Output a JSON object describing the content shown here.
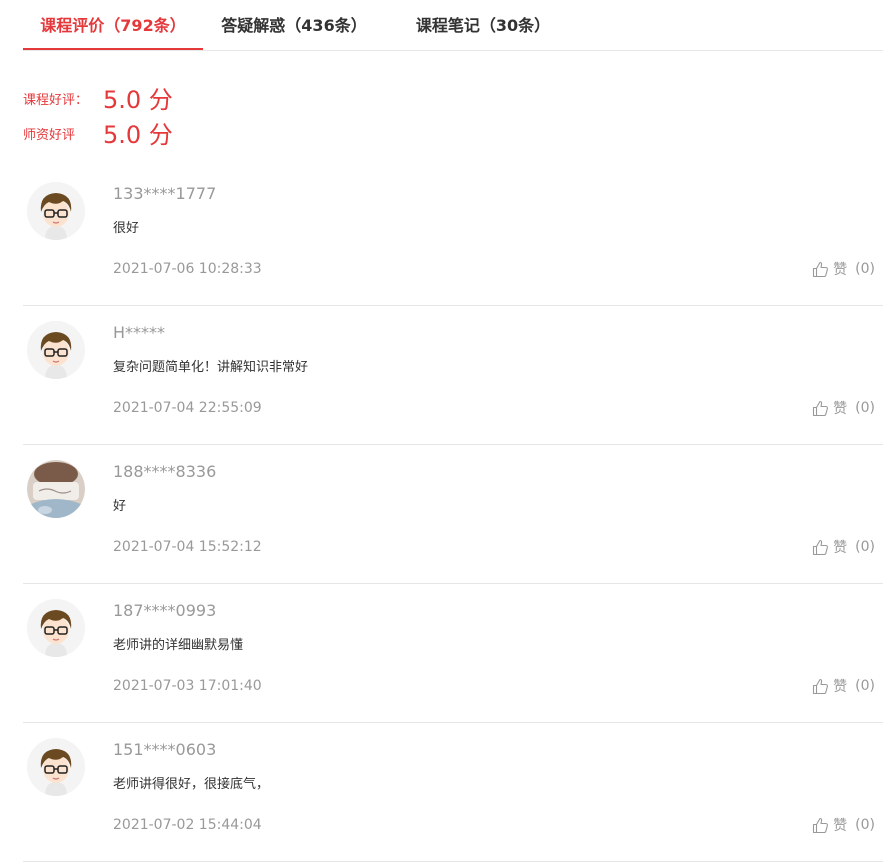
{
  "tabs": [
    {
      "label": "课程评价（792条）",
      "active": true
    },
    {
      "label": "答疑解惑（436条）",
      "active": false
    },
    {
      "label": "课程笔记（30条）",
      "active": false
    }
  ],
  "ratings": [
    {
      "label": "课程好评：",
      "value": "5.0 分"
    },
    {
      "label": "师资好评",
      "value": "5.0 分"
    }
  ],
  "comments": [
    {
      "user": "133****1777",
      "text": "很好",
      "time": "2021-07-06 10:28:33",
      "like_label": "赞",
      "like_count": "(0)",
      "avatar": "cartoon-boy-avatar"
    },
    {
      "user": "H*****",
      "text": "复杂问题简单化！讲解知识非常好",
      "time": "2021-07-04 22:55:09",
      "like_label": "赞",
      "like_count": "(0)",
      "avatar": "cartoon-boy-avatar"
    },
    {
      "user": "188****8336",
      "text": "好",
      "time": "2021-07-04 15:52:12",
      "like_label": "赞",
      "like_count": "(0)",
      "avatar": "photo-avatar"
    },
    {
      "user": "187****0993",
      "text": "老师讲的详细幽默易懂",
      "time": "2021-07-03 17:01:40",
      "like_label": "赞",
      "like_count": "(0)",
      "avatar": "cartoon-boy-avatar"
    },
    {
      "user": "151****0603",
      "text": "老师讲得很好，很接底气，",
      "time": "2021-07-02 15:44:04",
      "like_label": "赞",
      "like_count": "(0)",
      "avatar": "cartoon-boy-avatar"
    }
  ],
  "colors": {
    "accent": "#e5383b",
    "muted": "#999999",
    "divider": "#e6e6e6"
  }
}
